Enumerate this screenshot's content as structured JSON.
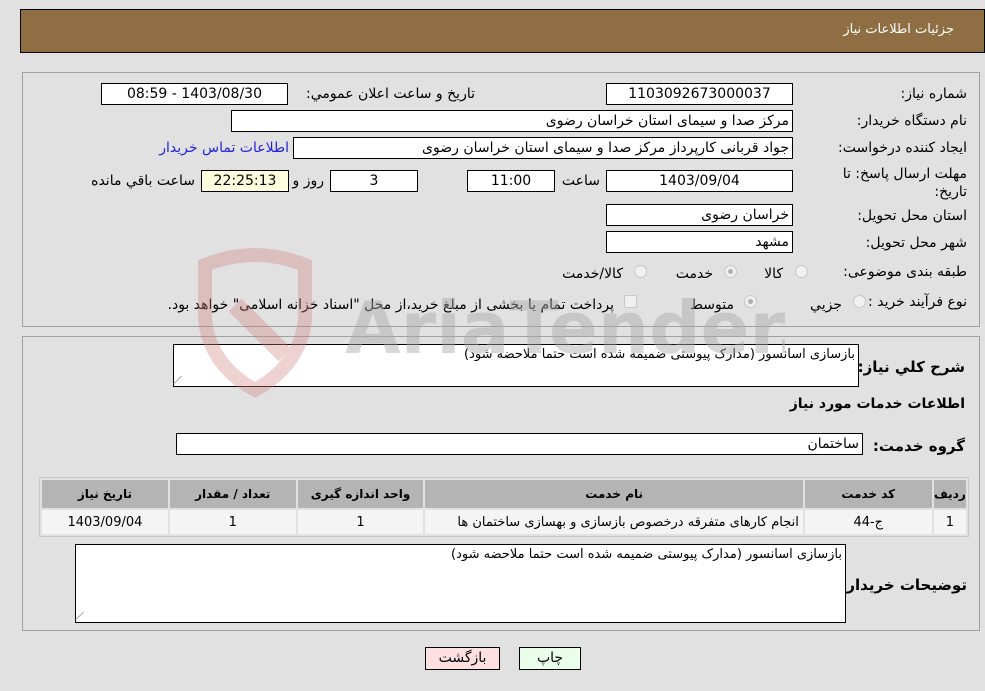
{
  "header": {
    "title": "جزئیات اطلاعات نیاز"
  },
  "details": {
    "need_number_label": "شماره نیاز:",
    "need_number": "1103092673000037",
    "announce_label": "تاریخ و ساعت اعلان عمومي:",
    "announce_value": "1403/08/30 - 08:59",
    "buyer_org_label": "نام دستگاه خریدار:",
    "buyer_org": "مرکز صدا و سیمای استان خراسان رضوی",
    "creator_label": "ایجاد کننده درخواست:",
    "creator": "جواد قربانی کارپرداز مرکز صدا و سیمای استان خراسان رضوی",
    "contact_link": "اطلاعات تماس خریدار",
    "deadline_label": "مهلت ارسال پاسخ: تا تاریخ:",
    "deadline_date": "1403/09/04",
    "time_label": "ساعت",
    "deadline_time": "11:00",
    "days_value": "3",
    "days_label": "روز و",
    "remaining_time": "22:25:13",
    "remaining_label": "ساعت باقي مانده",
    "province_label": "استان محل تحویل:",
    "province": "خراسان رضوی",
    "city_label": "شهر محل تحویل:",
    "city": "مشهد",
    "category_label": "طبقه بندی موضوعی:",
    "category_options": [
      {
        "label": "کالا",
        "checked": false
      },
      {
        "label": "خدمت",
        "checked": true
      },
      {
        "label": "کالا/خدمت",
        "checked": false
      }
    ],
    "process_label": "نوع فرآیند خرید :",
    "process_options": [
      {
        "label": "جزيي",
        "checked": false
      },
      {
        "label": "متوسط",
        "checked": true
      }
    ],
    "treasury_checkbox_label": "پرداخت تمام یا بخشی از مبلغ خرید،از محل \"اسناد خزانه اسلامی\" خواهد بود.",
    "treasury_checked": false
  },
  "services": {
    "summary_label": "شرح کلي نیاز:",
    "summary": "بازسازی اسانسور (مدارک پیوستی ضمیمه شده است حتما ملاحضه شود)",
    "section_title": "اطلاعات خدمات مورد نیاز",
    "group_label": "گروه خدمت:",
    "group": "ساختمان",
    "table": {
      "headers": [
        "ردیف",
        "کد خدمت",
        "نام خدمت",
        "واحد اندازه گیری",
        "تعداد / مقدار",
        "تاریخ نیاز"
      ],
      "rows": [
        [
          "1",
          "ج-44",
          "انجام کارهای متفرقه درخصوص بازسازی و بهسازی ساختمان ها",
          "1",
          "1",
          "1403/09/04"
        ]
      ]
    },
    "buyer_notes_label": "توضیحات خریدار:",
    "buyer_notes": "بازسازی اسانسور (مدارک پیوستی ضمیمه شده است حتما ملاحضه شود)"
  },
  "buttons": {
    "print": "چاپ",
    "back": "بازگشت"
  },
  "watermark": {
    "text": "AriaTender.neT"
  }
}
